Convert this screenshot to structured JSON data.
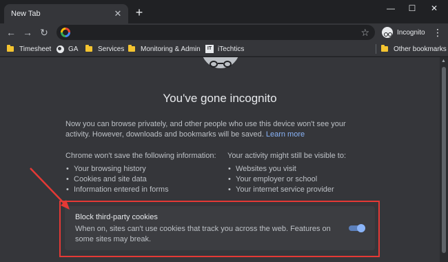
{
  "tab": {
    "title": "New Tab",
    "close": "✕",
    "new_tab": "+"
  },
  "window_controls": {
    "minimize": "—",
    "maximize": "☐",
    "close": "✕"
  },
  "toolbar": {
    "back": "←",
    "forward": "→",
    "reload": "↻",
    "omnibox_value": "",
    "star": "☆",
    "profile_label": "Incognito",
    "menu": "⋮"
  },
  "bookmarks": [
    {
      "label": "Timesheet",
      "icon": "folder-icon"
    },
    {
      "label": "GA",
      "icon": "globe-icon"
    },
    {
      "label": "Services",
      "icon": "folder-icon"
    },
    {
      "label": "Monitoring & Admin",
      "icon": "folder-icon"
    },
    {
      "label": "iTechtics",
      "icon": "itechtics-icon"
    },
    {
      "label": "Other bookmarks",
      "icon": "folder-icon"
    }
  ],
  "bookmark_icon_text": {
    "itechtics": "IT"
  },
  "content": {
    "headline": "You've gone incognito",
    "intro": "Now you can browse privately, and other people who use this device won't see your activity. However, downloads and bookmarks will be saved.",
    "learn_more": "Learn more",
    "left_column": {
      "heading": "Chrome won't save the following information:",
      "items": [
        "Your browsing history",
        "Cookies and site data",
        "Information entered in forms"
      ]
    },
    "right_column": {
      "heading": "Your activity might still be visible to:",
      "items": [
        "Websites you visit",
        "Your employer or school",
        "Your internet service provider"
      ]
    },
    "cookie_card": {
      "title": "Block third-party cookies",
      "description": "When on, sites can't use cookies that track you across the web. Features on some sites may break.",
      "toggle_on": true
    }
  },
  "colors": {
    "accent": "#8ab4f8",
    "annotation": "#e53935",
    "background": "#35363a"
  }
}
